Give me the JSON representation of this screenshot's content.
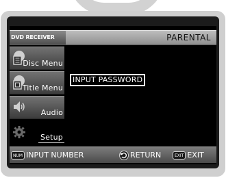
{
  "device_label": "DVD RECEIVER",
  "menu_title": "PARENTAL",
  "sidebar": {
    "items": [
      {
        "label": "Disc Menu",
        "icon": "disc-menu-icon",
        "selected": false
      },
      {
        "label": "Title Menu",
        "icon": "title-menu-icon",
        "selected": false
      },
      {
        "label": "Audio",
        "icon": "speaker-icon",
        "selected": false
      },
      {
        "label": "Setup",
        "icon": "gear-icon",
        "selected": true
      }
    ]
  },
  "content": {
    "prompt": "INPUT PASSWORD"
  },
  "footer": {
    "number_key": "NUM",
    "number_label": "INPUT NUMBER",
    "return_label": "RETURN",
    "exit_key": "EXIT",
    "exit_label": "EXIT"
  },
  "colors": {
    "screen_bg": "#000000",
    "bar_gray": "#9a9a9a",
    "text": "#ffffff"
  }
}
